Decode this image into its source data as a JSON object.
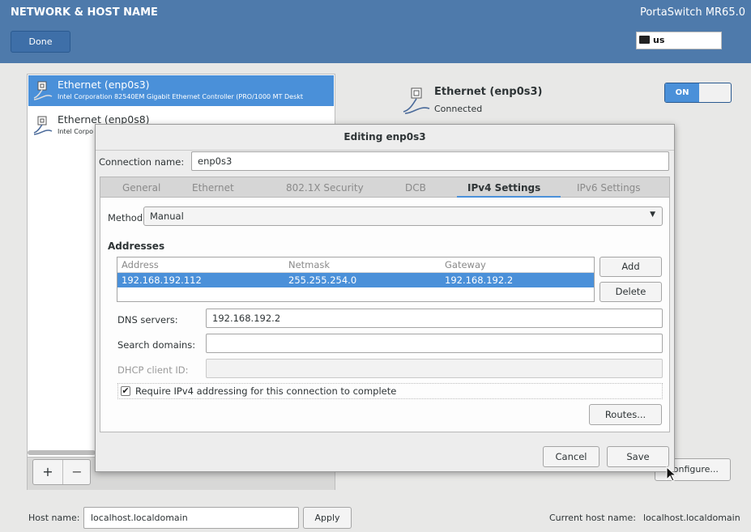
{
  "header": {
    "title": "NETWORK & HOST NAME",
    "done_label": "Done",
    "product": "PortaSwitch MR65.0",
    "keyboard_layout": "us"
  },
  "connections": [
    {
      "name": "Ethernet (enp0s3)",
      "description": "Intel Corporation 82540EM Gigabit Ethernet Controller (PRO/1000 MT Deskt",
      "selected": true,
      "icon": "ethernet-icon"
    },
    {
      "name": "Ethernet (enp0s8)",
      "description": "Intel Corpo",
      "selected": false,
      "icon": "ethernet-icon"
    }
  ],
  "list_controls": {
    "add_label": "+",
    "remove_label": "−"
  },
  "device": {
    "name": "Ethernet (enp0s3)",
    "status": "Connected",
    "switch_label": "ON",
    "configure_label": "Configure..."
  },
  "hostname": {
    "label": "Host name:",
    "value": "localhost.localdomain",
    "apply_label": "Apply",
    "current_label": "Current host name:",
    "current_value": "localhost.localdomain"
  },
  "dialog": {
    "title": "Editing enp0s3",
    "connection_name_label": "Connection name:",
    "connection_name_value": "enp0s3",
    "tabs": [
      {
        "label": "General",
        "active": false
      },
      {
        "label": "Ethernet",
        "active": false
      },
      {
        "label": "802.1X Security",
        "active": false
      },
      {
        "label": "DCB",
        "active": false
      },
      {
        "label": "IPv4 Settings",
        "active": true
      },
      {
        "label": "IPv6 Settings",
        "active": false
      }
    ],
    "method_label": "Method:",
    "method_value": "Manual",
    "addresses_heading": "Addresses",
    "address_columns": [
      "Address",
      "Netmask",
      "Gateway"
    ],
    "address_rows": [
      {
        "address": "192.168.192.112",
        "netmask": "255.255.254.0",
        "gateway": "192.168.192.2"
      }
    ],
    "add_label": "Add",
    "delete_label": "Delete",
    "dns_label": "DNS servers:",
    "dns_value": "192.168.192.2",
    "search_label": "Search domains:",
    "search_value": "",
    "dhcp_label": "DHCP client ID:",
    "dhcp_value": "",
    "require_label": "Require IPv4 addressing for this connection to complete",
    "require_checked": true,
    "routes_label": "Routes...",
    "cancel_label": "Cancel",
    "save_label": "Save"
  },
  "colors": {
    "header_bg": "#4e7aab",
    "accent": "#4a90d9"
  }
}
